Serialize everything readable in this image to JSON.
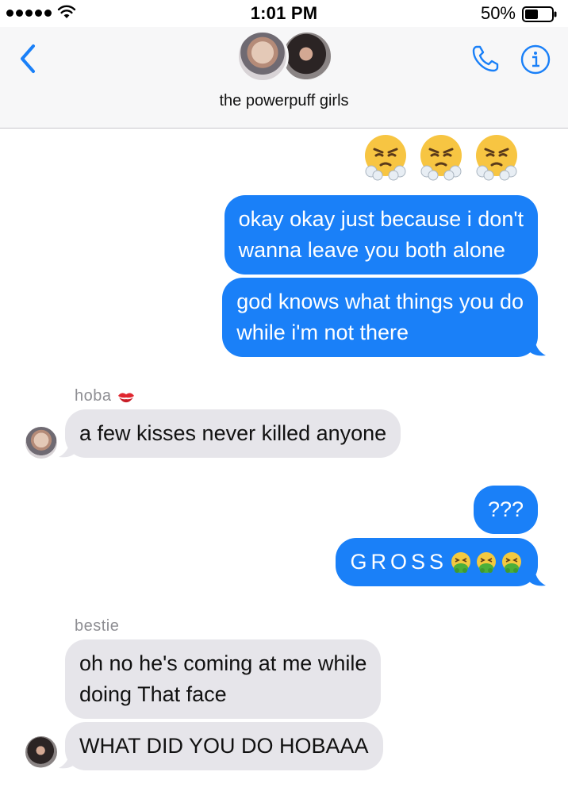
{
  "status_bar": {
    "time": "1:01 PM",
    "battery_percent": "50%",
    "signal_bars": 5,
    "battery_level": 0.5
  },
  "header": {
    "group_name": "the powerpuff girls",
    "back_icon": "chevron-left-icon",
    "call_icon": "phone-icon",
    "info_icon": "info-icon",
    "accent_color": "#1a80f8"
  },
  "messages": [
    {
      "direction": "outgoing",
      "type": "emoji",
      "emoji": [
        "face-with-steam-from-nose",
        "face-with-steam-from-nose",
        "face-with-steam-from-nose"
      ]
    },
    {
      "direction": "outgoing",
      "text_lines": [
        "okay okay just because i don't",
        "wanna leave you both alone"
      ]
    },
    {
      "direction": "outgoing",
      "text_lines": [
        "god knows what things you do",
        "while i'm not there"
      ]
    },
    {
      "direction": "incoming",
      "sender": "hoba",
      "sender_icon": "kiss-mark-icon",
      "text_lines": [
        "a few kisses never killed anyone"
      ]
    },
    {
      "direction": "outgoing",
      "text_lines": [
        "???"
      ]
    },
    {
      "direction": "outgoing",
      "text_lines": [
        "GROSS"
      ],
      "trailing_emoji": [
        "nauseated-face",
        "nauseated-face",
        "nauseated-face"
      ]
    },
    {
      "direction": "incoming",
      "sender": "bestie",
      "text_lines": [
        "oh no he's coming at me while",
        "doing That face"
      ]
    },
    {
      "direction": "incoming",
      "text_lines": [
        "WHAT DID YOU DO HOBAAA"
      ]
    }
  ],
  "colors": {
    "outgoing_bubble": "#1a80f8",
    "incoming_bubble": "#e6e5ea",
    "header_bg": "#f7f7f8"
  }
}
